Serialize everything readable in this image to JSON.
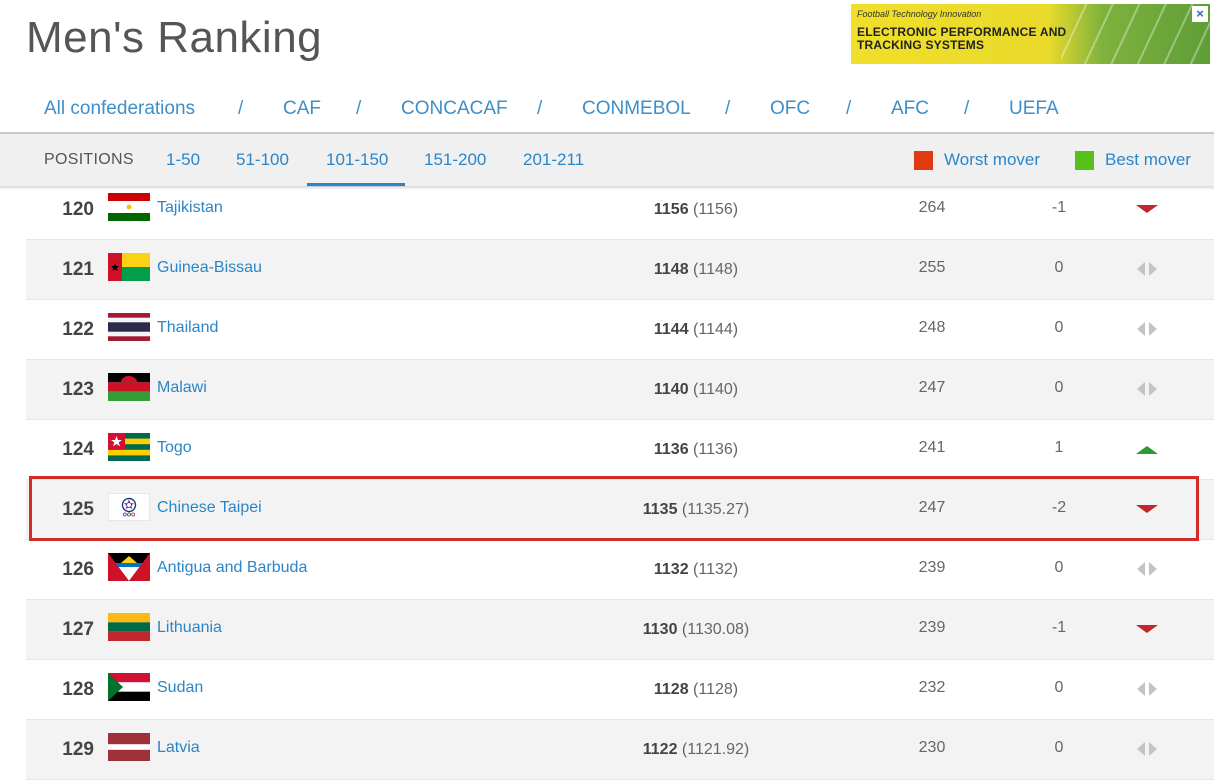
{
  "page": {
    "title": "Men's Ranking"
  },
  "ad": {
    "kicker": "Football Technology Innovation",
    "line1": "ELECTRONIC PERFORMANCE AND",
    "line2": "TRACKING SYSTEMS",
    "close": "×"
  },
  "confederations": {
    "items": [
      "All confederations",
      "CAF",
      "CONCACAF",
      "CONMEBOL",
      "OFC",
      "AFC",
      "UEFA"
    ],
    "separator": "/"
  },
  "positions": {
    "label": "POSITIONS",
    "ranges": [
      "1-50",
      "51-100",
      "101-150",
      "151-200",
      "201-211"
    ],
    "active": "101-150"
  },
  "legend": {
    "worst": {
      "label": "Worst mover",
      "color": "#e03a12"
    },
    "best": {
      "label": "Best mover",
      "color": "#57c01a"
    }
  },
  "colors": {
    "link": "#2a86c8",
    "down": "#c3272b",
    "up": "#2a9b3a",
    "neutral": "#c4c4c4",
    "highlight": "#d42a2a"
  },
  "rows": [
    {
      "rank": "120",
      "country": "Tajikistan",
      "flag": "tajikistan-flag",
      "points": "1156",
      "prev_points": "(1156)",
      "apps": "264",
      "move": "-1",
      "trend": "down"
    },
    {
      "rank": "121",
      "country": "Guinea-Bissau",
      "flag": "guinea-bissau-flag",
      "points": "1148",
      "prev_points": "(1148)",
      "apps": "255",
      "move": "0",
      "trend": "same"
    },
    {
      "rank": "122",
      "country": "Thailand",
      "flag": "thailand-flag",
      "points": "1144",
      "prev_points": "(1144)",
      "apps": "248",
      "move": "0",
      "trend": "same"
    },
    {
      "rank": "123",
      "country": "Malawi",
      "flag": "malawi-flag",
      "points": "1140",
      "prev_points": "(1140)",
      "apps": "247",
      "move": "0",
      "trend": "same"
    },
    {
      "rank": "124",
      "country": "Togo",
      "flag": "togo-flag",
      "points": "1136",
      "prev_points": "(1136)",
      "apps": "241",
      "move": "1",
      "trend": "up"
    },
    {
      "rank": "125",
      "country": "Chinese Taipei",
      "flag": "chinese-taipei-flag",
      "points": "1135",
      "prev_points": "(1135.27)",
      "apps": "247",
      "move": "-2",
      "trend": "down",
      "highlighted": true
    },
    {
      "rank": "126",
      "country": "Antigua and Barbuda",
      "flag": "antigua-and-barbuda-flag",
      "points": "1132",
      "prev_points": "(1132)",
      "apps": "239",
      "move": "0",
      "trend": "same"
    },
    {
      "rank": "127",
      "country": "Lithuania",
      "flag": "lithuania-flag",
      "points": "1130",
      "prev_points": "(1130.08)",
      "apps": "239",
      "move": "-1",
      "trend": "down"
    },
    {
      "rank": "128",
      "country": "Sudan",
      "flag": "sudan-flag",
      "points": "1128",
      "prev_points": "(1128)",
      "apps": "232",
      "move": "0",
      "trend": "same"
    },
    {
      "rank": "129",
      "country": "Latvia",
      "flag": "latvia-flag",
      "points": "1122",
      "prev_points": "(1121.92)",
      "apps": "230",
      "move": "0",
      "trend": "same"
    }
  ]
}
